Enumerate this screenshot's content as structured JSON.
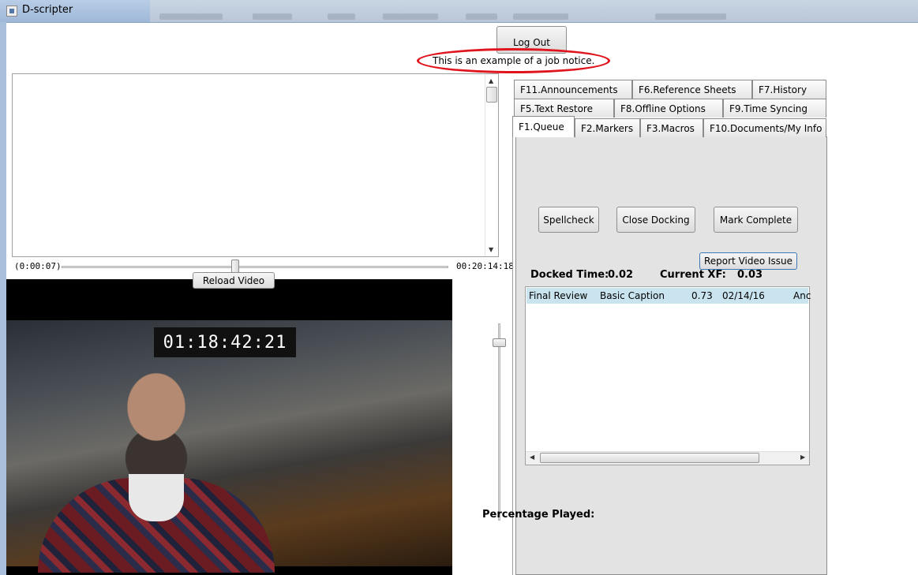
{
  "window": {
    "title": "D-scripter"
  },
  "header": {
    "logout_label": "Log Out",
    "job_notice": "This is an example of a job notice."
  },
  "timeline": {
    "start": "(0:00:07)",
    "end": "00:20:14:18",
    "reload_label": "Reload Video"
  },
  "video": {
    "timecode": "01:18:42:21"
  },
  "tabs": {
    "row1": [
      "F11.Announcements",
      "F6.Reference Sheets",
      "F7.History"
    ],
    "row2": [
      "F5.Text Restore",
      "F8.Offline Options",
      "F9.Time Syncing"
    ],
    "row3": [
      "F1.Queue",
      "F2.Markers",
      "F3.Macros",
      "F10.Documents/My Info"
    ],
    "active": "F1.Queue"
  },
  "queue": {
    "spellcheck_label": "Spellcheck",
    "close_docking_label": "Close Docking",
    "mark_complete_label": "Mark Complete",
    "report_video_label": "Report Video Issue",
    "docked_time_label": "Docked Time:",
    "docked_time_value": "0.02",
    "current_xf_label": "Current XF:",
    "current_xf_value": "0.03",
    "rows": [
      {
        "status": "Final Review",
        "type": "Basic Caption",
        "value": "0.73",
        "date": "02/14/16",
        "extra": "Anc"
      }
    ]
  },
  "percentage_played_label": "Percentage Played:",
  "colors": {
    "notice_ellipse": "#e0141c",
    "row_highlight": "#c9e4ee",
    "panel_bg": "#e3e3e3"
  }
}
